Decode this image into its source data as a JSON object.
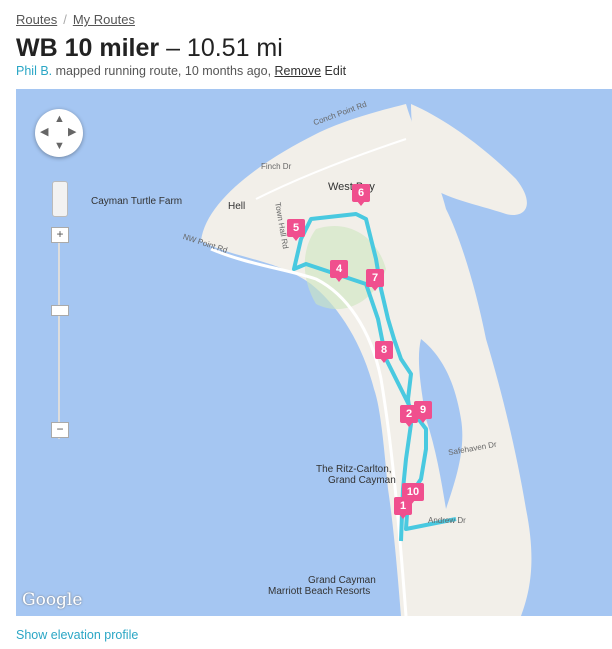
{
  "breadcrumb": {
    "item1": "Routes",
    "sep": "/",
    "item2": "My Routes"
  },
  "title": {
    "name": "WB 10 miler",
    "dash": "–",
    "distance": "10.51 mi"
  },
  "meta": {
    "user": "Phil B.",
    "text": " mapped running route, 10 months ago, ",
    "remove": "Remove",
    "edit": "Edit"
  },
  "map": {
    "labels": {
      "conch_point": "Conch Point Rd",
      "finch": "Finch Dr",
      "west_bay": "West Bay",
      "turtle_farm": "Cayman Turtle Farm",
      "hell": "Hell",
      "town_hall": "Town Hall Rd",
      "nw_point": "NW Point Rd",
      "ritz_1": "The Ritz-Carlton,",
      "ritz_2": "Grand Cayman",
      "safehaven": "Safehaven Dr",
      "andrew": "Andrew Dr",
      "marriott_1": "Grand Cayman",
      "marriott_2": "Marriott Beach Resorts",
      "google": "Google"
    },
    "markers": [
      "1",
      "2",
      "4",
      "5",
      "6",
      "7",
      "8",
      "9",
      "10"
    ],
    "zoom": {
      "plus": "+",
      "minus": "−"
    },
    "colors": {
      "water": "#a5c6f2",
      "land": "#f2efe9",
      "route": "#49c9e0",
      "marker": "#f04f8e"
    }
  },
  "elevation_link": "Show elevation profile"
}
